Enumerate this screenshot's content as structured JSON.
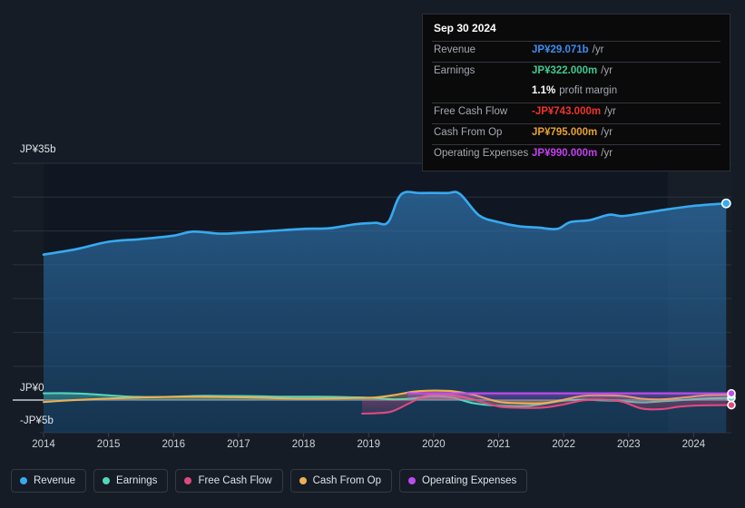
{
  "chart_data": {
    "type": "area",
    "title": "",
    "xlabel": "",
    "ylabel": "",
    "currency": "JP¥",
    "ylim": [
      -5,
      35
    ],
    "yticks": [
      {
        "value": 35,
        "label": "JP¥35b"
      },
      {
        "value": 0,
        "label": "JP¥0"
      },
      {
        "value": -5,
        "label": "-JP¥5b"
      }
    ],
    "gridlines": [
      35,
      30,
      25,
      20,
      15,
      10,
      5,
      0
    ],
    "grid": true,
    "legend_position": "bottom-left",
    "x": [
      2014,
      2015,
      2016,
      2017,
      2018,
      2019,
      2020,
      2021,
      2022,
      2023,
      2024
    ],
    "xticklabels": [
      "2014",
      "2015",
      "2016",
      "2017",
      "2018",
      "2019",
      "2020",
      "2021",
      "2022",
      "2023",
      "2024"
    ],
    "forecast_start": 2023.6,
    "series": [
      {
        "name": "Revenue",
        "color": "#37aaf0",
        "values": [
          21.5,
          23.4,
          24.3,
          24.7,
          25.3,
          26.2,
          30.5,
          26.1,
          27.3,
          27.6,
          29.071
        ],
        "end_value": 29.071,
        "points": [
          [
            2014.0,
            21.5
          ],
          [
            2014.5,
            22.3
          ],
          [
            2015.0,
            23.4
          ],
          [
            2015.5,
            23.8
          ],
          [
            2016.0,
            24.3
          ],
          [
            2016.3,
            24.9
          ],
          [
            2016.7,
            24.6
          ],
          [
            2017.0,
            24.7
          ],
          [
            2017.5,
            25.0
          ],
          [
            2018.0,
            25.3
          ],
          [
            2018.4,
            25.4
          ],
          [
            2018.8,
            26.0
          ],
          [
            2019.1,
            26.2
          ],
          [
            2019.3,
            26.3
          ],
          [
            2019.5,
            30.4
          ],
          [
            2019.8,
            30.6
          ],
          [
            2020.2,
            30.6
          ],
          [
            2020.4,
            30.5
          ],
          [
            2020.7,
            27.3
          ],
          [
            2021.0,
            26.3
          ],
          [
            2021.3,
            25.7
          ],
          [
            2021.6,
            25.5
          ],
          [
            2021.9,
            25.3
          ],
          [
            2022.1,
            26.3
          ],
          [
            2022.4,
            26.6
          ],
          [
            2022.7,
            27.4
          ],
          [
            2022.9,
            27.2
          ],
          [
            2023.2,
            27.6
          ],
          [
            2023.6,
            28.2
          ],
          [
            2024.0,
            28.7
          ],
          [
            2024.5,
            29.071
          ]
        ]
      },
      {
        "name": "Earnings",
        "color": "#53d6bd",
        "values": [
          1.0,
          0.7,
          0.5,
          0.55,
          0.5,
          0.3,
          0.6,
          -0.8,
          0.1,
          -0.3,
          0.322
        ],
        "end_value": 0.322
      },
      {
        "name": "Free Cash Flow",
        "color": "#e0497e",
        "values": [
          null,
          null,
          null,
          null,
          null,
          -1.3,
          0.8,
          -1.1,
          -0.1,
          -1.3,
          -0.743
        ],
        "end_value": -0.743,
        "starts_at": 2018.9
      },
      {
        "name": "Cash From Op",
        "color": "#eeb052",
        "values": [
          -0.3,
          0.2,
          0.4,
          0.45,
          0.2,
          0.35,
          1.35,
          -0.4,
          0.6,
          0.1,
          0.795
        ],
        "end_value": 0.795
      },
      {
        "name": "Operating Expenses",
        "color": "#c04bf0",
        "values": [
          null,
          null,
          null,
          null,
          null,
          1.0,
          1.0,
          1.0,
          1.0,
          1.0,
          0.99
        ],
        "end_value": 0.99,
        "starts_at": 2019.6
      }
    ]
  },
  "tooltip": {
    "date": "Sep 30 2024",
    "rows": [
      {
        "key": "Revenue",
        "value": "JP¥29.071b",
        "unit": "/yr",
        "color": "#3a8ef0"
      },
      {
        "key": "Earnings",
        "value": "JP¥322.000m",
        "unit": "/yr",
        "color": "#3fc98f"
      },
      {
        "key": "",
        "value": "1.1%",
        "unit": "profit margin",
        "color": "#ffffff",
        "noline": true
      },
      {
        "key": "Free Cash Flow",
        "value": "-JP¥743.000m",
        "unit": "/yr",
        "color": "#f0342a"
      },
      {
        "key": "Cash From Op",
        "value": "JP¥795.000m",
        "unit": "/yr",
        "color": "#e8a22c"
      },
      {
        "key": "Operating Expenses",
        "value": "JP¥990.000m",
        "unit": "/yr",
        "color": "#c040ee"
      }
    ]
  },
  "legend": {
    "items": [
      {
        "label": "Revenue",
        "color": "#37aaf0"
      },
      {
        "label": "Earnings",
        "color": "#53d6bd"
      },
      {
        "label": "Free Cash Flow",
        "color": "#e0497e"
      },
      {
        "label": "Cash From Op",
        "color": "#eeb052"
      },
      {
        "label": "Operating Expenses",
        "color": "#c04bf0"
      }
    ]
  },
  "axis": {
    "y_top": "JP¥35b",
    "y_zero": "JP¥0",
    "y_neg": "-JP¥5b"
  }
}
